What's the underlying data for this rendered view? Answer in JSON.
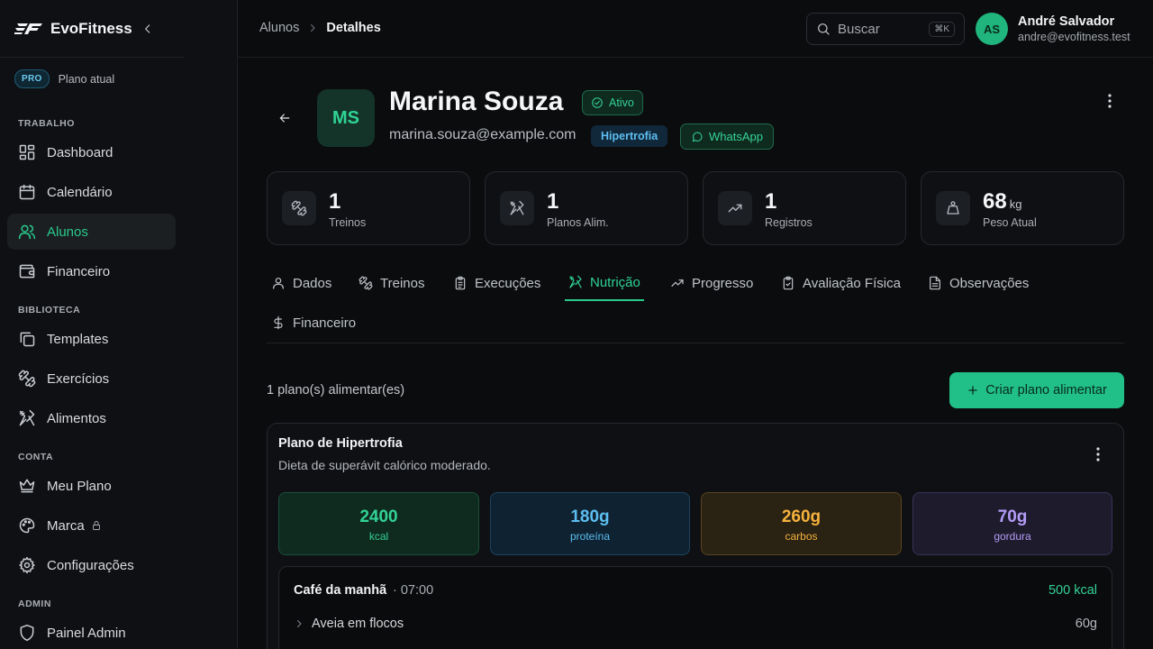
{
  "app": {
    "name": "EvoFitness"
  },
  "sidebar": {
    "plan_badge": "PRO",
    "plan_label": "Plano atual",
    "sections": {
      "work": "TRABALHO",
      "library": "BIBLIOTECA",
      "account": "CONTA",
      "admin": "ADMIN"
    },
    "items": {
      "dashboard": "Dashboard",
      "calendar": "Calendário",
      "students": "Alunos",
      "finance": "Financeiro",
      "templates": "Templates",
      "exercises": "Exercícios",
      "foods": "Alimentos",
      "my_plan": "Meu Plano",
      "brand": "Marca",
      "settings": "Configurações",
      "admin_panel": "Painel Admin"
    },
    "active_item": "students"
  },
  "header": {
    "breadcrumb": [
      "Alunos",
      "Detalhes"
    ],
    "search": {
      "placeholder": "Buscar",
      "shortcut": "⌘K"
    },
    "user": {
      "initials": "AS",
      "name": "André Salvador",
      "email": "andre@evofitness.test"
    }
  },
  "student": {
    "initials": "MS",
    "name": "Marina Souza",
    "status": "Ativo",
    "email": "marina.souza@example.com",
    "goal": "Hipertrofia",
    "whatsapp_label": "WhatsApp"
  },
  "stats": [
    {
      "value": "1",
      "unit": "",
      "label": "Treinos",
      "icon": "dumbbell-icon"
    },
    {
      "value": "1",
      "unit": "",
      "label": "Planos Alim.",
      "icon": "utensils-icon"
    },
    {
      "value": "1",
      "unit": "",
      "label": "Registros",
      "icon": "trending-up-icon"
    },
    {
      "value": "68",
      "unit": "kg",
      "label": "Peso Atual",
      "icon": "weight-icon"
    }
  ],
  "tabs": {
    "items": [
      "Dados",
      "Treinos",
      "Execuções",
      "Nutrição",
      "Progresso",
      "Avaliação Física",
      "Observações",
      "Financeiro"
    ],
    "active": "Nutrição"
  },
  "nutrition": {
    "count_text": "1 plano(s) alimentar(es)",
    "create_label": "Criar plano alimentar",
    "plan": {
      "title": "Plano de Hipertrofia",
      "description": "Dieta de superávit calórico moderado.",
      "macros": [
        {
          "value": "2400",
          "label": "kcal",
          "color": "#33d296"
        },
        {
          "value": "180g",
          "label": "proteína",
          "color": "#5cbef0"
        },
        {
          "value": "260g",
          "label": "carbos",
          "color": "#f5b23d"
        },
        {
          "value": "70g",
          "label": "gordura",
          "color": "#b49cf7"
        }
      ],
      "meals": [
        {
          "name": "Café da manhã",
          "time": "· 07:00",
          "kcal": "500 kcal",
          "foods": [
            {
              "name": "Aveia em flocos",
              "qty": "60g"
            }
          ]
        }
      ]
    }
  },
  "colors": {
    "accent": "#29c98c",
    "background": "#0b0c0e",
    "sidebar": "#0f1013"
  }
}
